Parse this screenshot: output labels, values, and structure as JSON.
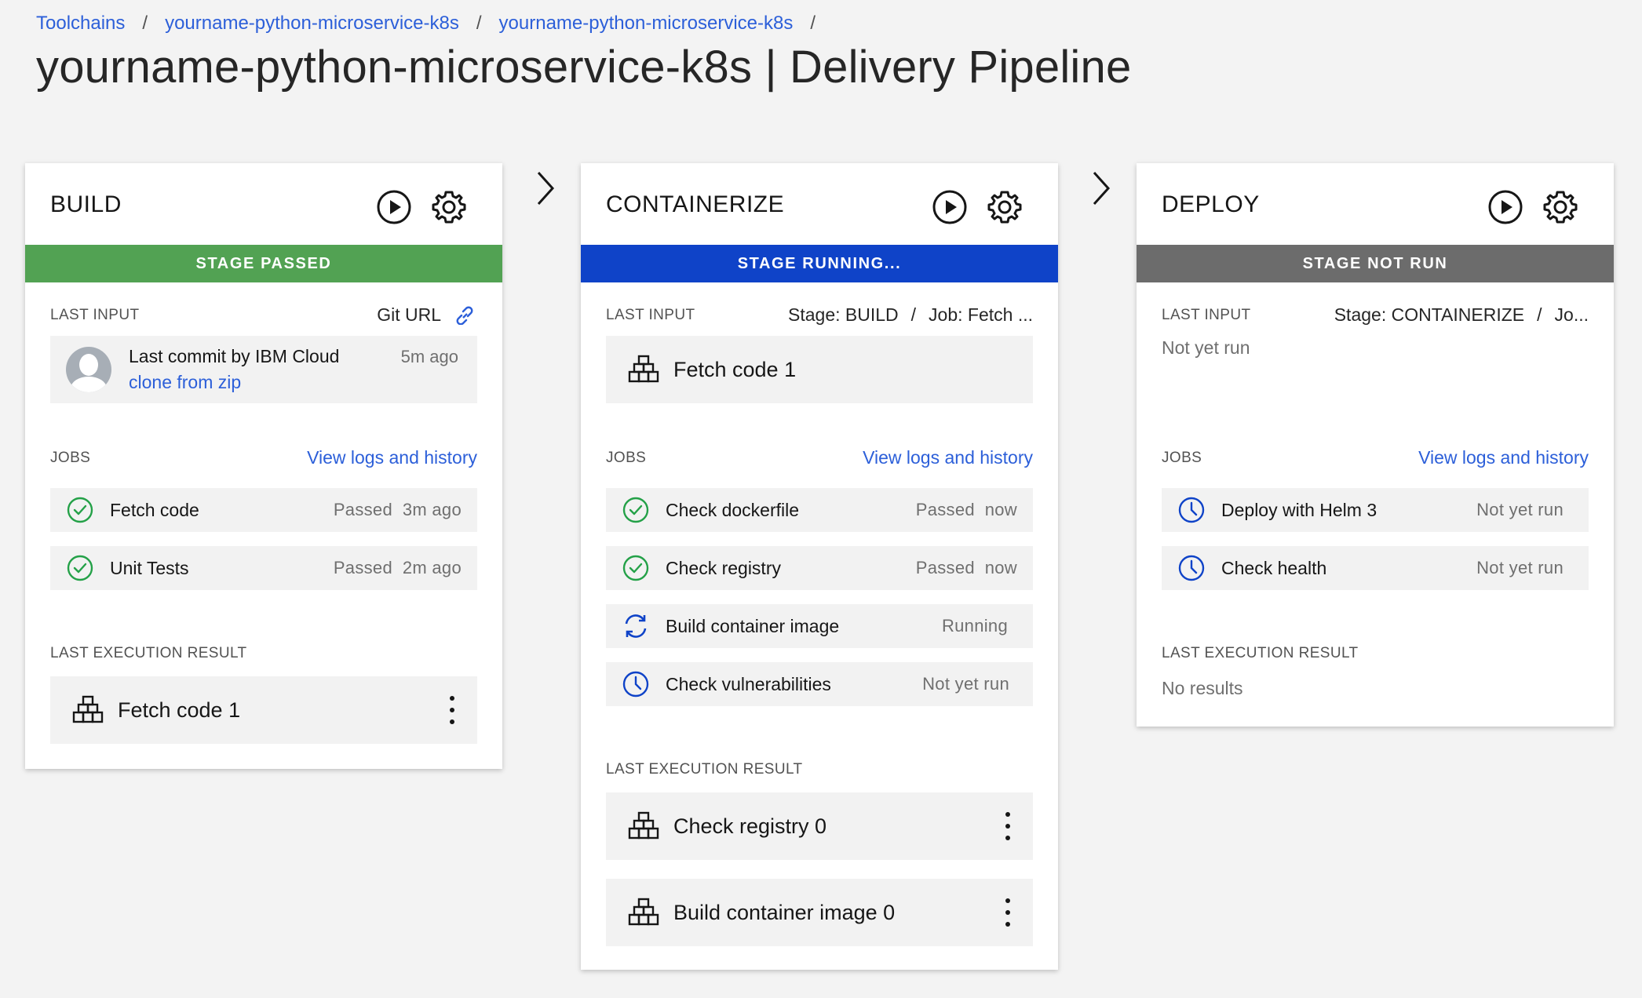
{
  "breadcrumb": [
    "Toolchains",
    "yourname-python-microservice-k8s",
    "yourname-python-microservice-k8s"
  ],
  "page_title": "yourname-python-microservice-k8s | Delivery Pipeline",
  "labels": {
    "last_input": "LAST INPUT",
    "jobs": "JOBS",
    "last_execution_result": "LAST EXECUTION RESULT",
    "view_logs": "View logs and history"
  },
  "stages": [
    {
      "title": "BUILD",
      "status": "STAGE PASSED",
      "status_color": "#52a253",
      "input_source": "Git URL",
      "commit": {
        "title": "Last commit by IBM Cloud",
        "message": "clone from zip",
        "time": "5m ago"
      },
      "jobs": [
        {
          "name": "Fetch code",
          "status": "Passed  3m ago",
          "icon": "check-circle-icon"
        },
        {
          "name": "Unit Tests",
          "status": "Passed  2m ago",
          "icon": "check-circle-icon"
        }
      ],
      "results": [
        "Fetch code 1"
      ]
    },
    {
      "title": "CONTAINERIZE",
      "status": "STAGE RUNNING...",
      "status_color": "#0f43c8",
      "input_stage": "Stage: BUILD",
      "input_job": "Job: Fetch ...",
      "input_result": "Fetch code 1",
      "jobs": [
        {
          "name": "Check dockerfile",
          "status": "Passed  now",
          "icon": "check-circle-icon"
        },
        {
          "name": "Check registry",
          "status": "Passed  now",
          "icon": "check-circle-icon"
        },
        {
          "name": "Build container image",
          "status": "Running",
          "icon": "refresh-icon"
        },
        {
          "name": "Check vulnerabilities",
          "status": "Not yet run",
          "icon": "clock-icon"
        }
      ],
      "results": [
        "Check registry 0",
        "Build container image 0"
      ]
    },
    {
      "title": "DEPLOY",
      "status": "STAGE NOT RUN",
      "status_color": "#6c6c6c",
      "input_stage": "Stage: CONTAINERIZE",
      "input_job": "Jo...",
      "not_yet_run": "Not yet run",
      "jobs": [
        {
          "name": "Deploy with Helm 3",
          "status": "Not yet run",
          "icon": "clock-icon"
        },
        {
          "name": "Check health",
          "status": "Not yet run",
          "icon": "clock-icon"
        }
      ],
      "no_results": "No results"
    }
  ],
  "colors": {
    "link": "#2c5fd9",
    "success": "#24a148",
    "info": "#0f43c8"
  }
}
